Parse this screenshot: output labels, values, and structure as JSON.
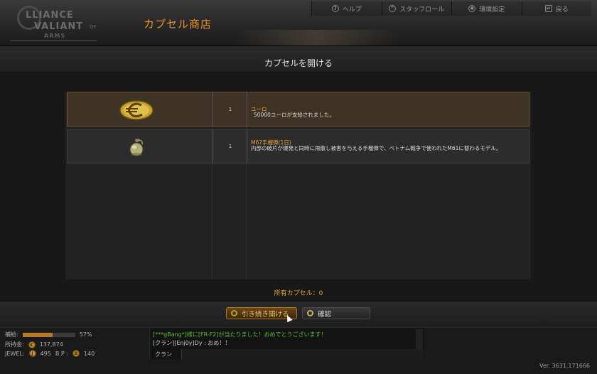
{
  "header": {
    "logo": {
      "line1": "LLIANCE",
      "line2": "VALIANT",
      "of": "OF",
      "line3": "ARMS"
    },
    "page_title": "カプセル商店",
    "nav": [
      {
        "label": "ヘルプ",
        "icon": "help-icon"
      },
      {
        "label": "スタッフロール",
        "icon": "staff-roll-icon"
      },
      {
        "label": "環境設定",
        "icon": "gear-icon"
      },
      {
        "label": "戻る",
        "icon": "back-icon"
      }
    ]
  },
  "dialog": {
    "title": "カプセルを開ける",
    "items": [
      {
        "icon": "euro-coin-icon",
        "qty": "1",
        "name": "ユーロ",
        "desc": "50000ユーロが支給されました。",
        "highlighted": true
      },
      {
        "icon": "grenade-icon",
        "qty": "1",
        "name": "M67手榴弾(1日)",
        "desc": "内部の破片が爆発と同時に飛散し被害を与える手榴弾で、ベトナム戦争で使われたM61に替わるモデル。",
        "highlighted": false
      }
    ],
    "capsule_count": "所有カプセル：0",
    "buttons": {
      "continue": "引き続き開ける",
      "confirm": "確認"
    }
  },
  "status": {
    "supply_label": "補給:",
    "supply_fraction": 0.57,
    "supply_percent": "57%",
    "money_label": "所持金:",
    "money": "137,874",
    "jewel_label": "JEWEL:",
    "jewel": "495",
    "bp_label": "B.P :",
    "bp": "140"
  },
  "chat": {
    "lines": [
      {
        "text": "[***gBang*]様に[FR-F2]が当たりました！おめでとうございます！",
        "color": "green"
      },
      {
        "text": "[クラン][Enj0y]Dy : おめ！！",
        "color": "white"
      }
    ],
    "tab_label": "クラン"
  },
  "version": "Ver. 3631.171666",
  "colors": {
    "accent": "#e7a83b",
    "title_orange": "#e5952e",
    "highlight_row": "#3e3324",
    "chat_green": "#5fbf3a"
  }
}
